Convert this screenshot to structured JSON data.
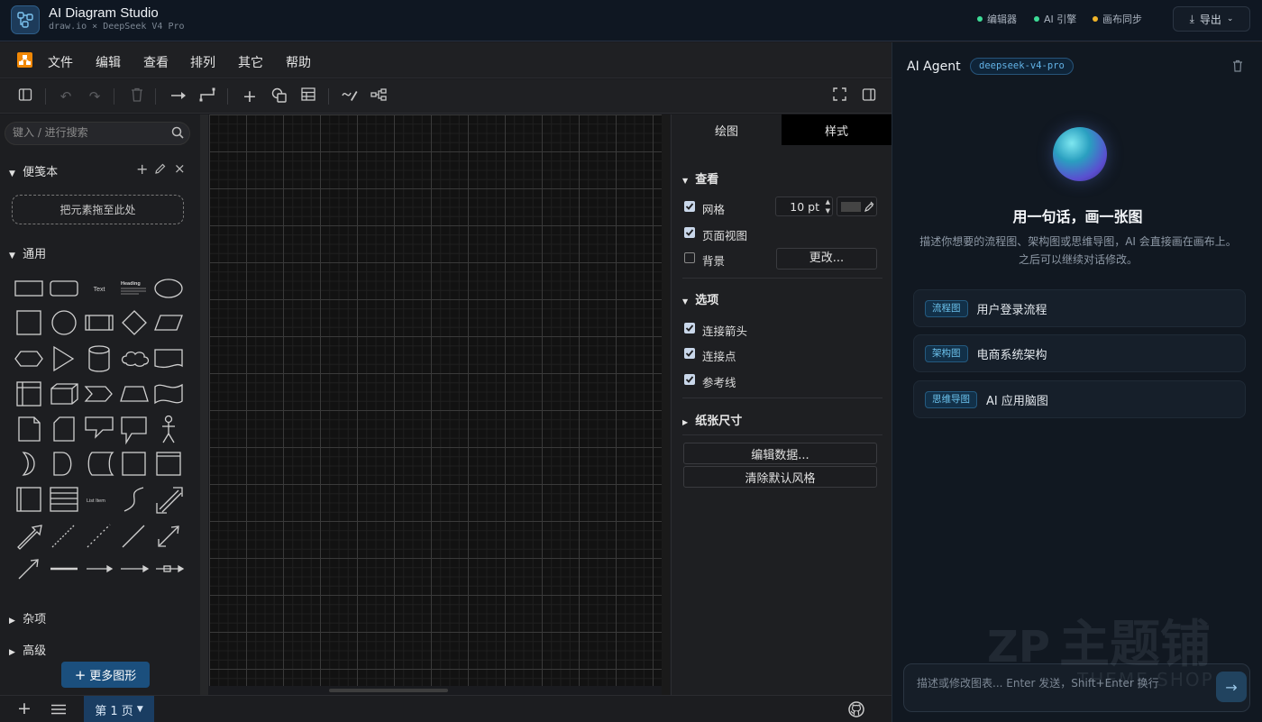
{
  "app": {
    "title": "AI Diagram Studio",
    "subtitle": "draw.io × DeepSeek V4 Pro"
  },
  "status": [
    {
      "label": "编辑器",
      "color": "#3ddc97"
    },
    {
      "label": "AI 引擎",
      "color": "#3ddc97"
    },
    {
      "label": "画布同步",
      "color": "#f0b429"
    }
  ],
  "export_label": "导出",
  "menu": [
    "文件",
    "编辑",
    "查看",
    "排列",
    "其它",
    "帮助"
  ],
  "sidebar": {
    "search_placeholder": "键入 / 进行搜索",
    "scratchpad": "便笺本",
    "drop_hint": "把元素拖至此处",
    "general": "通用",
    "misc": "杂项",
    "advanced": "高级",
    "more_shapes": "更多图形",
    "shape_text": "Text",
    "shape_heading": "Heading",
    "shape_list_item": "List Item"
  },
  "format": {
    "tabs": [
      "绘图",
      "样式"
    ],
    "view_title": "查看",
    "grid": "网格",
    "grid_size": "10 pt",
    "page_view": "页面视图",
    "background": "背景",
    "change": "更改...",
    "options_title": "选项",
    "connection_arrows": "连接箭头",
    "connection_points": "连接点",
    "guides": "参考线",
    "paper_size": "纸张尺寸",
    "edit_data": "编辑数据...",
    "clear_style": "清除默认风格"
  },
  "page_tab": "第 1 页",
  "agent": {
    "title": "AI Agent",
    "model": "deepseek-v4-pro",
    "hero": "用一句话，画一张图",
    "desc": "描述你想要的流程图、架构图或思维导图，AI 会直接画在画布上。之后可以继续对话修改。",
    "suggestions": [
      {
        "tag": "流程图",
        "text": "用户登录流程"
      },
      {
        "tag": "架构图",
        "text": "电商系统架构"
      },
      {
        "tag": "思维导图",
        "text": "AI 应用脑图"
      }
    ],
    "input_placeholder": "描述或修改图表... Enter 发送，Shift+Enter 换行"
  },
  "watermark": {
    "brand": "主题铺",
    "sub": "THEME SHOP"
  }
}
